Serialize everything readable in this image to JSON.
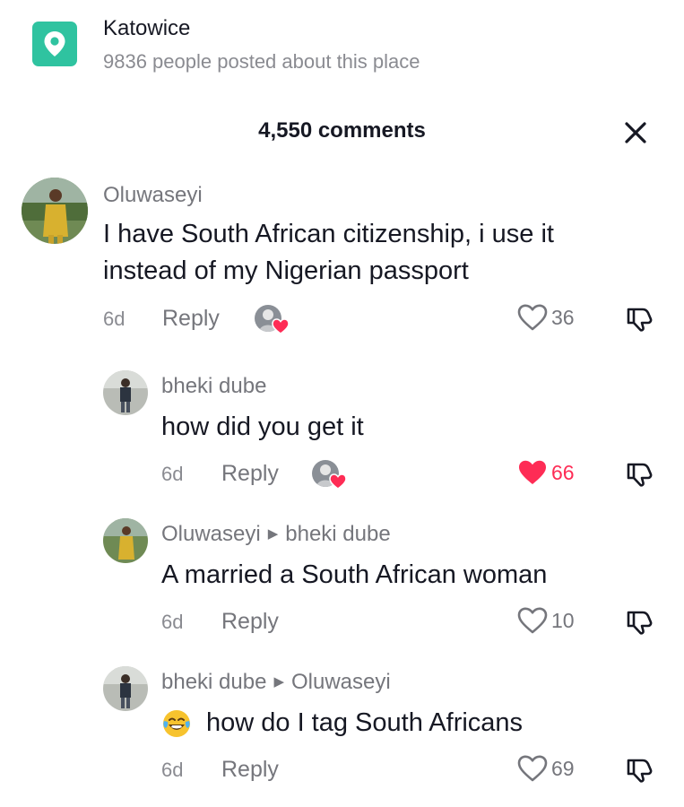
{
  "place": {
    "name": "Katowice",
    "subtitle": "9836 people posted about this place",
    "icon": "location-pin-icon",
    "accent": "#2fc3a0"
  },
  "comments_header": {
    "title": "4,550 comments",
    "close_icon": "close-icon"
  },
  "comments": [
    {
      "author": "Oluwaseyi",
      "text": "I have South African citizenship, i use it instead of my Nigerian passport",
      "age": "6d",
      "reply_label": "Reply",
      "likes": "36",
      "liked": false,
      "creator_liked": true
    },
    {
      "author": "bheki dube",
      "text": "how did you get it",
      "age": "6d",
      "reply_label": "Reply",
      "likes": "66",
      "liked": true,
      "creator_liked": true
    },
    {
      "author": "Oluwaseyi",
      "reply_to": "bheki dube",
      "text": "A married a South African woman",
      "age": "6d",
      "reply_label": "Reply",
      "likes": "10",
      "liked": false
    },
    {
      "author": "bheki dube",
      "reply_to": "Oluwaseyi",
      "text": "how do I tag South Africans",
      "leading_emoji": "face-with-tears-of-joy-emoji",
      "age": "6d",
      "reply_label": "Reply",
      "likes": "69",
      "liked": false
    }
  ],
  "colors": {
    "like_red": "#fe2c55",
    "muted": "#75767c",
    "text": "#161823"
  }
}
